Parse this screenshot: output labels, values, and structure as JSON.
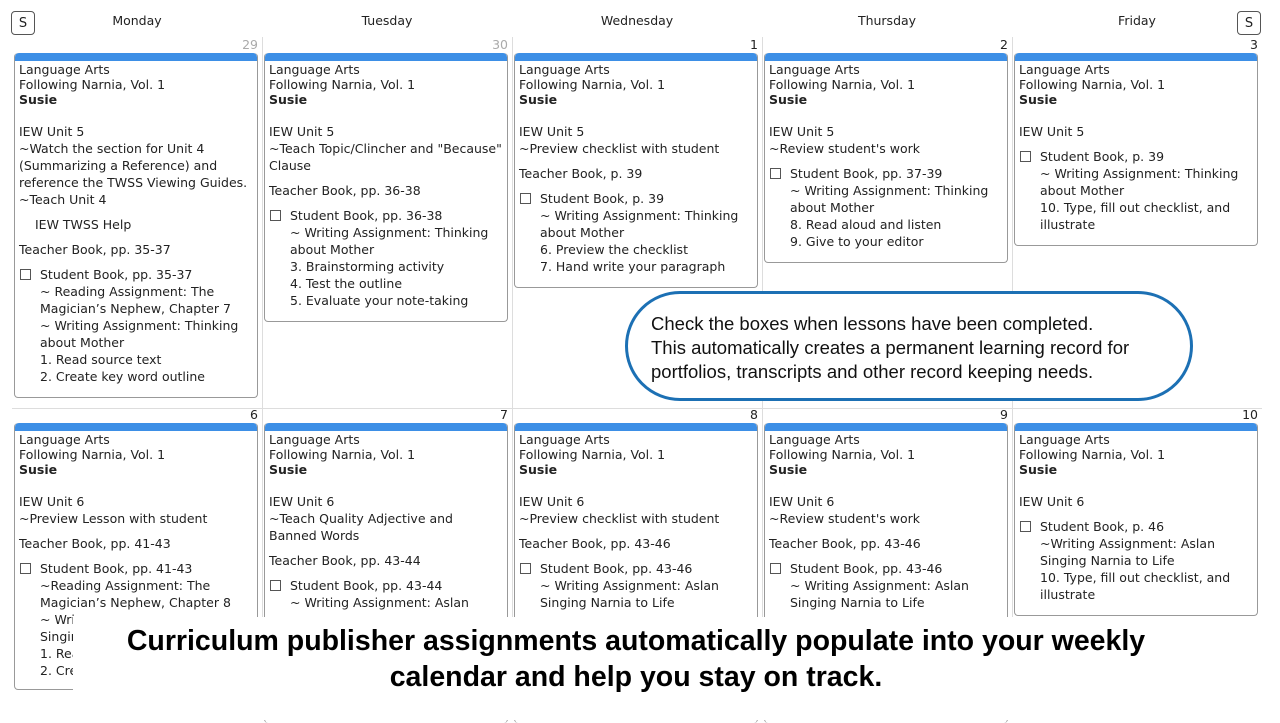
{
  "nav": {
    "prev_label": "S",
    "next_label": "S"
  },
  "days": [
    "Monday",
    "Tuesday",
    "Wednesday",
    "Thursday",
    "Friday"
  ],
  "weeks": [
    {
      "dates": [
        "29",
        "30",
        "1",
        "2",
        "3"
      ],
      "dim": [
        true,
        true,
        false,
        false,
        false
      ],
      "cards": [
        {
          "subject": "Language Arts",
          "curriculum": "Following Narnia, Vol. 1",
          "student": "Susie",
          "blocks": [
            {
              "type": "text",
              "lines": [
                "IEW Unit 5",
                "~Watch the section for Unit 4 (Summarizing a Reference) and reference the TWSS Viewing Guides.",
                "~Teach Unit 4"
              ]
            },
            {
              "type": "link",
              "text": "IEW TWSS Help"
            },
            {
              "type": "text",
              "lines": [
                "Teacher Book, pp. 35-37"
              ]
            },
            {
              "type": "check",
              "label": "Student Book, pp. 35-37",
              "sub": [
                "~ Reading Assignment: The Magician’s Nephew, Chapter 7",
                "~ Writing Assignment: Thinking about Mother",
                "1. Read source text",
                "2. Create key word outline"
              ]
            }
          ]
        },
        {
          "subject": "Language Arts",
          "curriculum": "Following Narnia, Vol. 1",
          "student": "Susie",
          "blocks": [
            {
              "type": "text",
              "lines": [
                "IEW Unit 5",
                "~Teach Topic/Clincher and \"Because\" Clause"
              ]
            },
            {
              "type": "text",
              "lines": [
                "Teacher Book, pp. 36-38"
              ]
            },
            {
              "type": "check",
              "label": "Student Book, pp. 36-38",
              "sub": [
                "~ Writing Assignment: Thinking about Mother",
                "3. Brainstorming activity",
                "4. Test the outline",
                "5. Evaluate your note-taking"
              ]
            }
          ]
        },
        {
          "subject": "Language Arts",
          "curriculum": "Following Narnia, Vol. 1",
          "student": "Susie",
          "blocks": [
            {
              "type": "text",
              "lines": [
                "IEW Unit 5",
                "~Preview checklist with student"
              ]
            },
            {
              "type": "text",
              "lines": [
                "Teacher Book, p. 39"
              ]
            },
            {
              "type": "check",
              "label": "Student Book, p. 39",
              "sub": [
                "~ Writing Assignment: Thinking about Mother",
                "6. Preview the checklist",
                "7. Hand write your paragraph"
              ]
            }
          ]
        },
        {
          "subject": "Language Arts",
          "curriculum": "Following Narnia, Vol. 1",
          "student": "Susie",
          "blocks": [
            {
              "type": "text",
              "lines": [
                "IEW Unit 5",
                "~Review student's work"
              ]
            },
            {
              "type": "check",
              "label": "Student Book, pp. 37-39",
              "sub": [
                "~ Writing Assignment: Thinking about Mother",
                "8. Read aloud and listen",
                "9. Give to your editor"
              ]
            }
          ]
        },
        {
          "subject": "Language Arts",
          "curriculum": "Following Narnia, Vol. 1",
          "student": "Susie",
          "blocks": [
            {
              "type": "text",
              "lines": [
                "IEW Unit 5"
              ]
            },
            {
              "type": "check",
              "label": "Student Book, p. 39",
              "sub": [
                "~ Writing Assignment: Thinking about Mother",
                "10. Type, fill out checklist, and illustrate"
              ]
            }
          ]
        }
      ]
    },
    {
      "dates": [
        "6",
        "7",
        "8",
        "9",
        "10"
      ],
      "dim": [
        false,
        false,
        false,
        false,
        false
      ],
      "cards": [
        {
          "subject": "Language Arts",
          "curriculum": "Following Narnia, Vol. 1",
          "student": "Susie",
          "blocks": [
            {
              "type": "text",
              "lines": [
                "IEW Unit 6",
                "~Preview Lesson with student"
              ]
            },
            {
              "type": "text",
              "lines": [
                "Teacher Book, pp. 41-43"
              ]
            },
            {
              "type": "check",
              "label": "Student Book, pp. 41-43",
              "sub": [
                "~Reading Assignment: The Magician’s Nephew, Chapter 8",
                "~ Wri",
                "Singir",
                "1. Rea",
                "2. Cre"
              ]
            }
          ]
        },
        {
          "subject": "Language Arts",
          "curriculum": "Following Narnia, Vol. 1",
          "student": "Susie",
          "blocks": [
            {
              "type": "text",
              "lines": [
                "IEW Unit 6",
                "~Teach Quality Adjective and Banned Words"
              ]
            },
            {
              "type": "text",
              "lines": [
                "Teacher Book, pp. 43-44"
              ]
            },
            {
              "type": "check",
              "label": "Student Book, pp. 43-44",
              "sub": [
                "~ Writing Assignment: Aslan"
              ]
            }
          ]
        },
        {
          "subject": "Language Arts",
          "curriculum": "Following Narnia, Vol. 1",
          "student": "Susie",
          "blocks": [
            {
              "type": "text",
              "lines": [
                "IEW Unit 6",
                "~Preview checklist with student"
              ]
            },
            {
              "type": "text",
              "lines": [
                "Teacher Book, pp. 43-46"
              ]
            },
            {
              "type": "check",
              "label": "Student Book, pp. 43-46",
              "sub": [
                "~ Writing Assignment: Aslan Singing Narnia to Life"
              ]
            }
          ]
        },
        {
          "subject": "Language Arts",
          "curriculum": "Following Narnia, Vol. 1",
          "student": "Susie",
          "blocks": [
            {
              "type": "text",
              "lines": [
                "IEW Unit 6",
                "~Review student's work"
              ]
            },
            {
              "type": "text",
              "lines": [
                "Teacher Book, pp. 43-46"
              ]
            },
            {
              "type": "check",
              "label": "Student Book, pp. 43-46",
              "sub": [
                "~ Writing Assignment: Aslan Singing Narnia to Life"
              ]
            }
          ]
        },
        {
          "subject": "Language Arts",
          "curriculum": "Following Narnia, Vol. 1",
          "student": "Susie",
          "blocks": [
            {
              "type": "text",
              "lines": [
                "IEW Unit 6"
              ]
            },
            {
              "type": "check",
              "label": "Student Book, p. 46",
              "sub": [
                "~Writing Assignment: Aslan Singing Narnia to Life",
                "10. Type, fill out checklist, and illustrate"
              ]
            }
          ]
        }
      ]
    }
  ],
  "callout": {
    "lines": [
      "Check the boxes when lessons have been completed.",
      "This automatically creates a permanent learning record for",
      "portfolios, transcripts and other record keeping needs."
    ]
  },
  "banner": {
    "lines": [
      "Curriculum publisher assignments automatically populate into your weekly",
      "calendar and help you stay on track."
    ]
  },
  "colors": {
    "card_bar": "#3d8fe6",
    "callout_border": "#1c70b4"
  }
}
